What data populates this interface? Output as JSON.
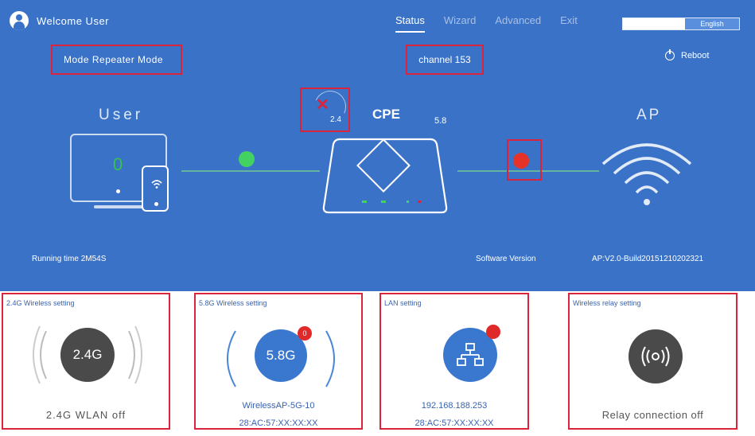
{
  "header": {
    "welcome": "Welcome User",
    "nav": [
      "Status",
      "Wizard",
      "Advanced",
      "Exit"
    ],
    "active_nav": "Status",
    "language": "English"
  },
  "status": {
    "mode": "Mode Repeater Mode",
    "channel": "channel 153",
    "reboot": "Reboot",
    "user_label": "User",
    "user_count": "0",
    "cpe_label": "CPE",
    "band_24": "2.4",
    "band_58": "5.8",
    "ap_label": "AP",
    "running_time": "Running time  2M54S",
    "software_version_label": "Software Version",
    "software_version_value": "AP:V2.0-Build20151210202321"
  },
  "cards": {
    "wlan24": {
      "title": "2.4G Wireless setting",
      "icon_text": "2.4G",
      "status": "2.4G WLAN off"
    },
    "wlan58": {
      "title": "5.8G Wireless setting",
      "icon_text": "5.8G",
      "badge": "0",
      "ssid": "WirelessAP-5G-10",
      "mac": "28:AC:57:XX:XX:XX"
    },
    "lan": {
      "title": "LAN setting",
      "ip": "192.168.188.253",
      "mac": "28:AC:57:XX:XX:XX"
    },
    "relay": {
      "title": "Wireless relay setting",
      "status": "Relay connection off"
    }
  },
  "colors": {
    "hero_bg": "#3a72c8",
    "highlight_box": "#d9243c",
    "connected": "#43d163",
    "disconnected": "#e5332a",
    "card_text": "#3a63b0"
  }
}
